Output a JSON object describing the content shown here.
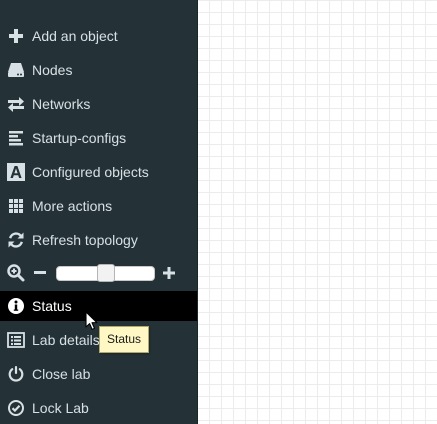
{
  "sidebar": {
    "items": [
      {
        "label": "Add an object",
        "icon": "plus-icon"
      },
      {
        "label": "Nodes",
        "icon": "hdd-icon"
      },
      {
        "label": "Networks",
        "icon": "transfer-icon"
      },
      {
        "label": "Startup-configs",
        "icon": "align-left-icon"
      },
      {
        "label": "Configured objects",
        "icon": "font-icon"
      },
      {
        "label": "More actions",
        "icon": "th-icon"
      },
      {
        "label": "Refresh topology",
        "icon": "refresh-icon"
      },
      {
        "label": "Status",
        "icon": "info-sign-icon",
        "active": true
      },
      {
        "label": "Lab details",
        "icon": "list-alt-icon"
      },
      {
        "label": "Close lab",
        "icon": "off-icon"
      },
      {
        "label": "Lock Lab",
        "icon": "ok-circle-icon"
      }
    ],
    "zoom": {
      "icon": "zoom-in-icon",
      "minus_label": "−",
      "plus_label": "+",
      "level_fraction": 0.5
    }
  },
  "tooltip": {
    "text": "Status"
  },
  "colors": {
    "sidebar_bg": "#243238",
    "active_bg": "#000000",
    "text": "#d7e0e4",
    "tooltip_bg": "#fff8c4",
    "canvas_grid": "#ececec"
  }
}
